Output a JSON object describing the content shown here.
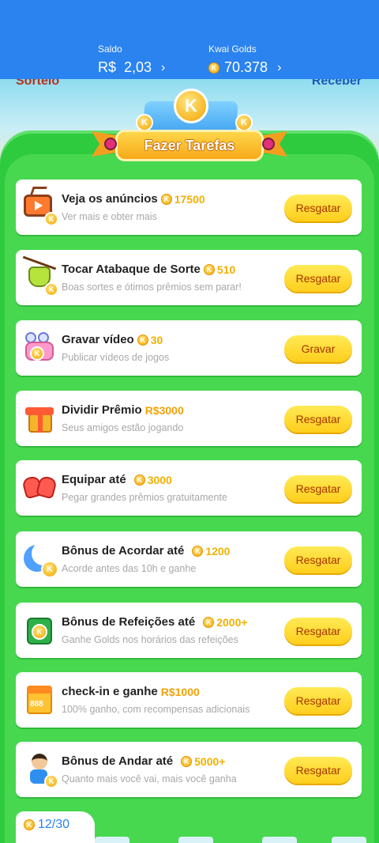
{
  "header": {
    "balance_label": "Saldo",
    "balance_value": "R$  2,03",
    "golds_label": "Kwai Golds",
    "golds_value": "70.378",
    "chevron": "›"
  },
  "scene": {
    "left_text": "Sorteio",
    "right_text": "Receber"
  },
  "banner": {
    "title": "Fazer Tarefas",
    "coin_letter": "K"
  },
  "tasks": [
    {
      "title": "Veja os anúncios",
      "reward": "17500",
      "reward_type": "coin",
      "subtitle": "Ver mais e obter mais",
      "button": "Resgatar",
      "icon": "tv-icon"
    },
    {
      "title": "Tocar Atabaque de Sorte",
      "reward": "510",
      "reward_type": "coin",
      "subtitle": "Boas sortes e ótimos prêmios sem parar!",
      "button": "Resgatar",
      "icon": "drum-icon"
    },
    {
      "title": "Gravar vídeo",
      "reward": "30",
      "reward_type": "coin",
      "subtitle": "Publicar vídeos de jogos",
      "button": "Gravar",
      "icon": "video-camera-icon"
    },
    {
      "title": "Dividir Prêmio",
      "reward": "R$3000",
      "reward_type": "money",
      "subtitle": "Seus amigos estão jogando",
      "button": "Resgatar",
      "icon": "gift-box-icon"
    },
    {
      "title": "Equipar até",
      "reward": "3000",
      "reward_type": "coin",
      "subtitle": "Pegar grandes prêmios gratuitamente",
      "button": "Resgatar",
      "icon": "boxing-gloves-icon"
    },
    {
      "title": "Bônus de Acordar até",
      "reward": "1200",
      "reward_type": "coin",
      "subtitle": "Acorde antes das 10h e ganhe",
      "button": "Resgatar",
      "icon": "moon-icon"
    },
    {
      "title": "Bônus de Refeições até",
      "reward": "2000+",
      "reward_type": "coin",
      "subtitle": "Ganhe Golds nos horários das refeições",
      "button": "Resgatar",
      "icon": "meal-bag-icon"
    },
    {
      "title": "check-in e ganhe",
      "reward": "R$1000",
      "reward_type": "money",
      "subtitle": "100% ganho, com recompensas adicionais",
      "button": "Resgatar",
      "icon": "calendar-icon"
    },
    {
      "title": "Bônus de Andar até",
      "reward": "5000+",
      "reward_type": "coin",
      "subtitle": "Quanto mais você vai, mais você ganha",
      "button": "Resgatar",
      "icon": "walking-boy-icon"
    }
  ],
  "calendar_number": "888",
  "progress": {
    "text": "12/30"
  },
  "colors": {
    "header_blue": "#2a83ee",
    "green": "#2ecb3e",
    "button_yellow": "#ffd82e",
    "gold": "#f1b000"
  }
}
